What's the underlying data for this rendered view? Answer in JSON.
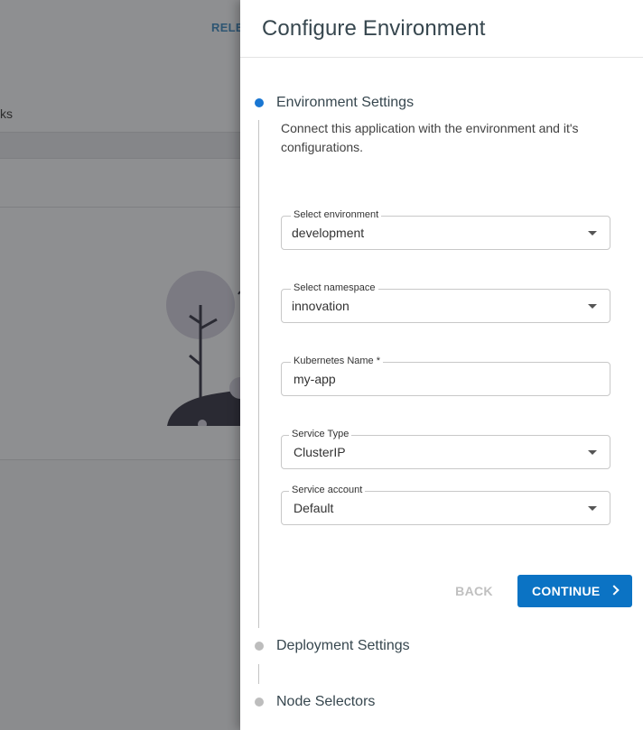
{
  "background": {
    "release_label": "RELEA",
    "tab_label": "ks"
  },
  "drawer": {
    "title": "Configure Environment"
  },
  "steps": [
    {
      "title": "Environment Settings",
      "state": "active"
    },
    {
      "title": "Deployment Settings",
      "state": "inactive"
    },
    {
      "title": "Node Selectors",
      "state": "inactive"
    }
  ],
  "environment_step": {
    "description": "Connect this application with the environment and it's configurations.",
    "fields": {
      "environment": {
        "label": "Select environment",
        "value": "development",
        "type": "select"
      },
      "namespace": {
        "label": "Select namespace",
        "value": "innovation",
        "type": "select"
      },
      "kubernetes_name": {
        "label": "Kubernetes Name *",
        "value": "my-app",
        "type": "text"
      },
      "service_type": {
        "label": "Service Type",
        "value": "ClusterIP",
        "type": "select"
      },
      "service_account": {
        "label": "Service account",
        "value": "Default",
        "type": "select"
      }
    },
    "back_label": "BACK",
    "continue_label": "CONTINUE"
  },
  "colors": {
    "accent": "#0b73c4",
    "active_step": "#1976d2",
    "inactive_step": "#bdbdbd",
    "overlay": "#8e8f91"
  }
}
